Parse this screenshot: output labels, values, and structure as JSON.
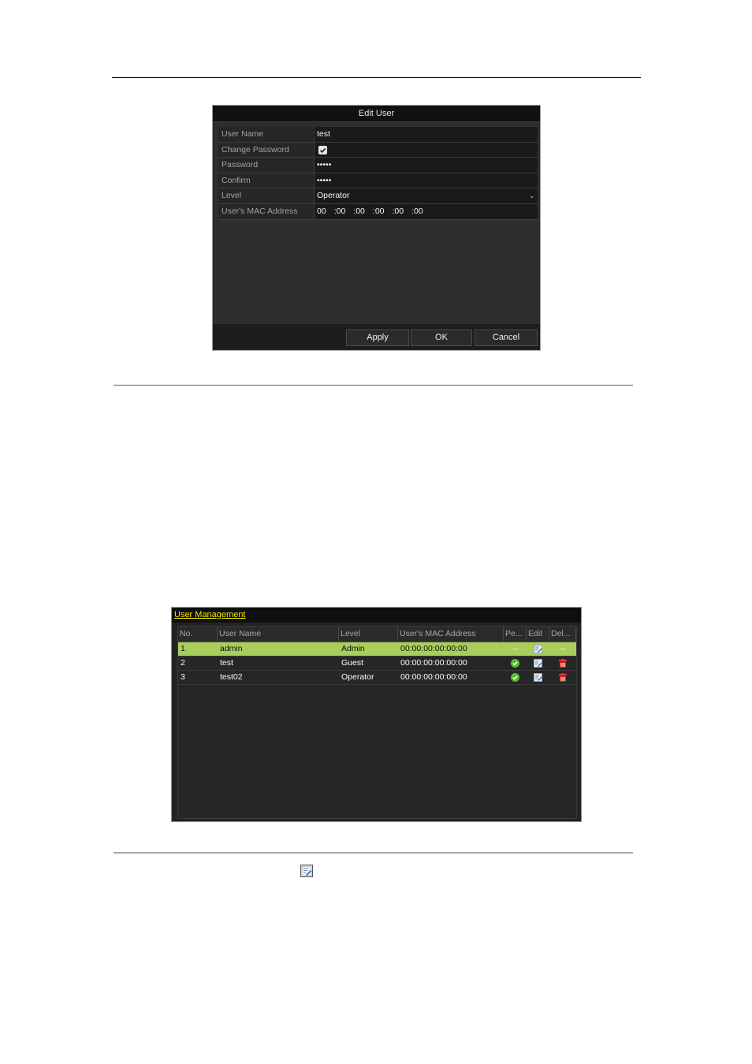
{
  "edit_user": {
    "title": "Edit User",
    "fields": {
      "user_name": {
        "label": "User Name",
        "value": "test"
      },
      "change_password": {
        "label": "Change Password",
        "checked": true
      },
      "password": {
        "label": "Password",
        "value": "•••••"
      },
      "confirm": {
        "label": "Confirm",
        "value": "•••••"
      },
      "level": {
        "label": "Level",
        "value": "Operator"
      },
      "mac": {
        "label": "User's MAC Address",
        "octets": [
          "00",
          ":00",
          ":00",
          ":00",
          ":00",
          ":00"
        ]
      }
    },
    "buttons": {
      "apply": "Apply",
      "ok": "OK",
      "cancel": "Cancel"
    }
  },
  "user_management": {
    "title": "User Management",
    "columns": [
      "No.",
      "User Name",
      "Level",
      "User's MAC Address",
      "Pe...",
      "Edit",
      "Del..."
    ],
    "rows": [
      {
        "no": "1",
        "name": "admin",
        "level": "Admin",
        "mac": "00:00:00:00:00:00",
        "selected": true,
        "permission": "none",
        "edit": "edit-icon",
        "delete": "none"
      },
      {
        "no": "2",
        "name": "test",
        "level": "Guest",
        "mac": "00:00:00:00:00:00",
        "selected": false,
        "permission": "permission-icon",
        "edit": "edit-icon",
        "delete": "delete-icon"
      },
      {
        "no": "3",
        "name": "test02",
        "level": "Operator",
        "mac": "00:00:00:00:00:00",
        "selected": false,
        "permission": "permission-icon",
        "edit": "edit-icon",
        "delete": "delete-icon"
      }
    ]
  },
  "colors": {
    "selected_row": "#a8cf5c",
    "panel_title": "#f2e600",
    "permission_icon": "#4fbf2b",
    "delete_icon": "#d0281e"
  }
}
